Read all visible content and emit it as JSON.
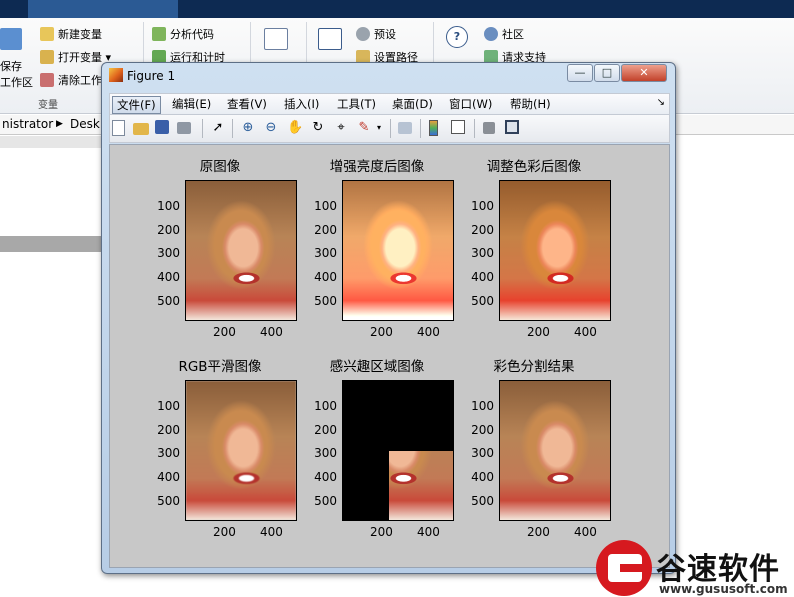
{
  "ribbon": {
    "save_label": "保存",
    "workspace_label": "工作区",
    "new_variable": "新建变量",
    "open_variable": "打开变量",
    "clear_workspace": "清除工作",
    "group_variable": "变量",
    "analyze_code": "分析代码",
    "run_and_time": "运行和计时",
    "preferences": "预设",
    "set_path": "设置路径",
    "community": "社区",
    "request_support": "请求支持"
  },
  "address": {
    "seg1": "nistrator",
    "seg2": "Desk"
  },
  "figure": {
    "title": "Figure 1",
    "window_buttons": [
      "—",
      "□",
      "✕"
    ],
    "menu": [
      "文件(F)",
      "编辑(E)",
      "查看(V)",
      "插入(I)",
      "工具(T)",
      "桌面(D)",
      "窗口(W)",
      "帮助(H)"
    ],
    "menu_overflow": "↘",
    "toolbar_icons": [
      "new-figure-icon",
      "open-file-icon",
      "save-icon",
      "print-icon",
      "edit-plot-arrow-icon",
      "zoom-in-icon",
      "zoom-out-icon",
      "pan-hand-icon",
      "rotate-3d-icon",
      "data-cursor-icon",
      "brush-icon",
      "brush-dropdown-icon",
      "link-plot-icon",
      "colorbar-icon",
      "legend-icon",
      "hide-plot-tools-icon",
      "show-plot-tools-icon"
    ],
    "axes": [
      {
        "title": "原图像",
        "yticks": [
          "100",
          "200",
          "300",
          "400",
          "500"
        ],
        "xticks": [
          "200",
          "400"
        ]
      },
      {
        "title": "增强亮度后图像",
        "yticks": [
          "100",
          "200",
          "300",
          "400",
          "500"
        ],
        "xticks": [
          "200",
          "400"
        ]
      },
      {
        "title": "调整色彩后图像",
        "yticks": [
          "100",
          "200",
          "300",
          "400",
          "500"
        ],
        "xticks": [
          "200",
          "400"
        ]
      },
      {
        "title": "RGB平滑图像",
        "yticks": [
          "100",
          "200",
          "300",
          "400",
          "500"
        ],
        "xticks": [
          "200",
          "400"
        ]
      },
      {
        "title": "感兴趣区域图像",
        "yticks": [
          "100",
          "200",
          "300",
          "400",
          "500"
        ],
        "xticks": [
          "200",
          "400"
        ]
      },
      {
        "title": "彩色分割结果",
        "yticks": [
          "100",
          "200",
          "300",
          "400",
          "500"
        ],
        "xticks": [
          "200",
          "400"
        ]
      }
    ]
  },
  "watermark": {
    "brand": "谷速软件",
    "url": "www.gususoft.com"
  },
  "colors": {
    "figure_bg": "#c8c8c8",
    "title_bar": "#cfe0f1",
    "close_button": "#c2412a",
    "watermark_red": "#d6191f"
  }
}
